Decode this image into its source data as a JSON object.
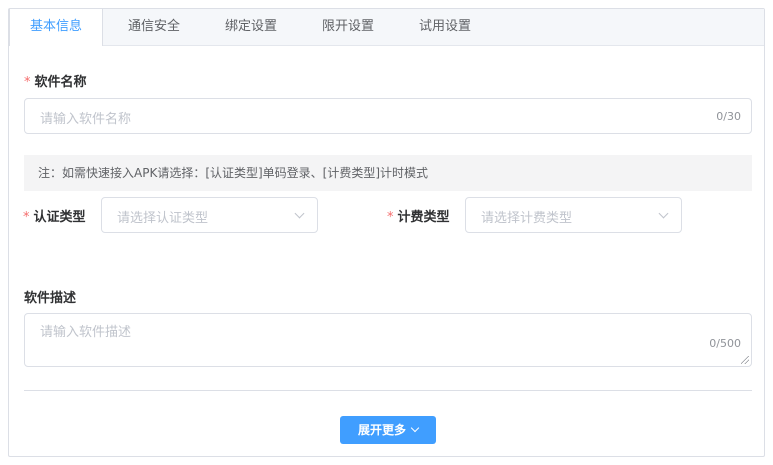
{
  "tabs": [
    {
      "label": "基本信息"
    },
    {
      "label": "通信安全"
    },
    {
      "label": "绑定设置"
    },
    {
      "label": "限开设置"
    },
    {
      "label": "试用设置"
    }
  ],
  "form": {
    "required_mark": "*",
    "software_name": {
      "label": "软件名称",
      "placeholder": "请输入软件名称",
      "counter": "0/30"
    },
    "notice": "注：如需快速接入APK请选择：[认证类型]单码登录、[计费类型]计时模式",
    "auth_type": {
      "label": "认证类型",
      "placeholder": "请选择认证类型"
    },
    "billing_type": {
      "label": "计费类型",
      "placeholder": "请选择计费类型"
    },
    "description": {
      "label": "软件描述",
      "placeholder": "请输入软件描述",
      "counter": "0/500"
    }
  },
  "expand_button": {
    "label": "展开更多"
  },
  "colors": {
    "primary": "#409eff",
    "required": "#f56c6c"
  }
}
